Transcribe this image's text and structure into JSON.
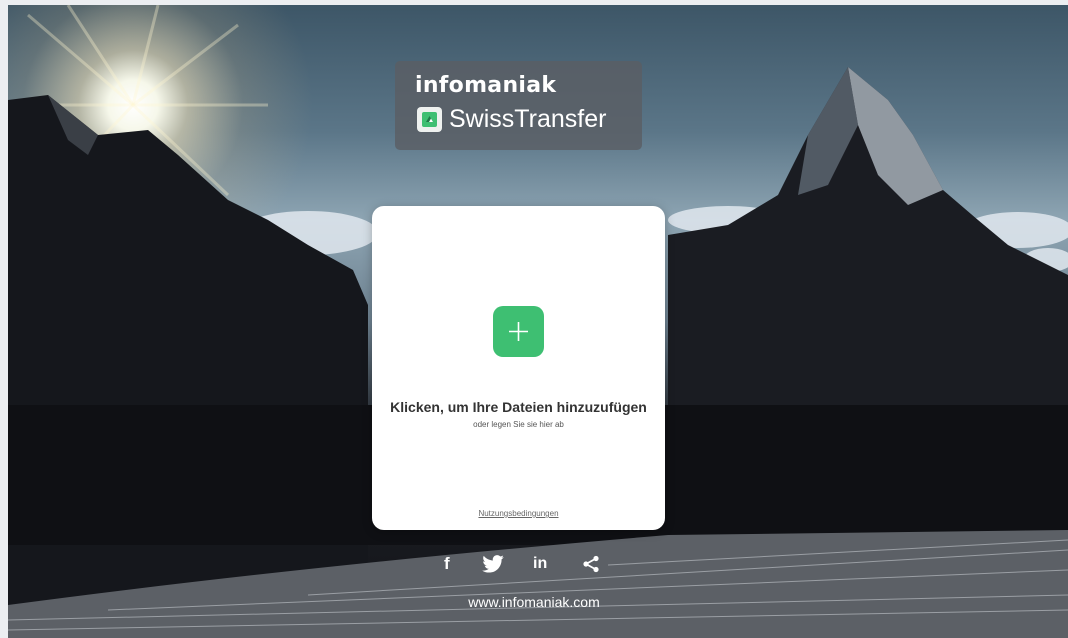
{
  "logo": {
    "brand": "infomaniak",
    "product": "SwissTransfer",
    "icon": "swisstransfer-logo-icon"
  },
  "upload": {
    "title": "Klicken, um Ihre Dateien hinzuzufügen",
    "subtitle": "oder legen Sie sie hier ab",
    "terms": "Nutzungsbedingungen",
    "button_icon": "plus-icon"
  },
  "social": {
    "facebook": "f",
    "linkedin": "in",
    "icons": [
      "facebook-icon",
      "twitter-icon",
      "linkedin-icon",
      "share-icon"
    ]
  },
  "footer": {
    "website": "www.infomaniak.com"
  },
  "colors": {
    "accent_green": "#3ebf72",
    "card_bg": "#ffffff",
    "logo_bg": "#5a5e64"
  }
}
